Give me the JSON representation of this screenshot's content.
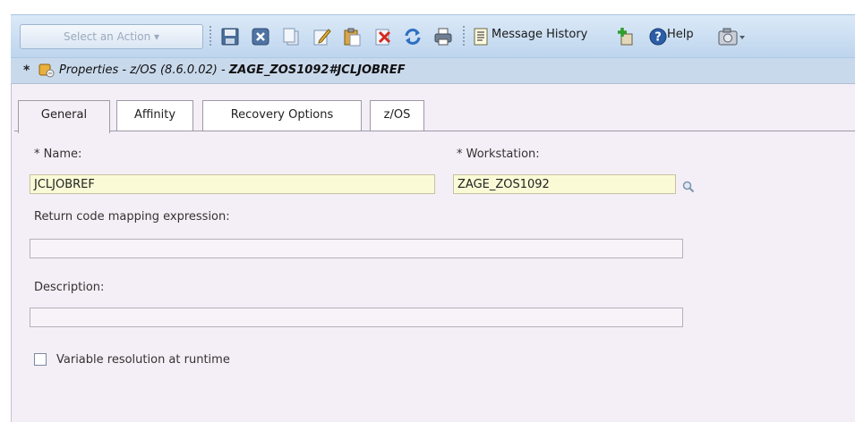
{
  "toolbar": {
    "action_select": "Select an Action ▾",
    "message_history": "Message History",
    "help": "Help",
    "icons": [
      "save-icon",
      "close-icon",
      "copy-icon",
      "edit-icon",
      "paste-icon",
      "delete-icon",
      "refresh-icon",
      "print-icon",
      "message-history-icon",
      "add-icon",
      "help-icon",
      "screenshot-icon"
    ]
  },
  "title": {
    "modified_marker": "*",
    "prefix": "Properties - z/OS (8.6.0.02) - ",
    "object": "ZAGE_ZOS1092#JCLJOBREF"
  },
  "tabs": [
    {
      "label": "General",
      "active": true
    },
    {
      "label": "Affinity",
      "active": false
    },
    {
      "label": "Recovery Options",
      "active": false
    },
    {
      "label": "z/OS",
      "active": false
    }
  ],
  "form": {
    "name_label": "* Name:",
    "name_value": "JCLJOBREF",
    "workstation_label": "* Workstation:",
    "workstation_value": "ZAGE_ZOS1092",
    "return_code_label": "Return code mapping expression:",
    "return_code_value": "",
    "description_label": "Description:",
    "description_value": "",
    "variable_resolution_label": "Variable resolution at runtime",
    "variable_resolution_checked": false
  },
  "colors": {
    "required_field_bg": "#fafbd6",
    "panel_bg": "#f4eef6",
    "toolbar_bg": "#c9dbf0"
  }
}
